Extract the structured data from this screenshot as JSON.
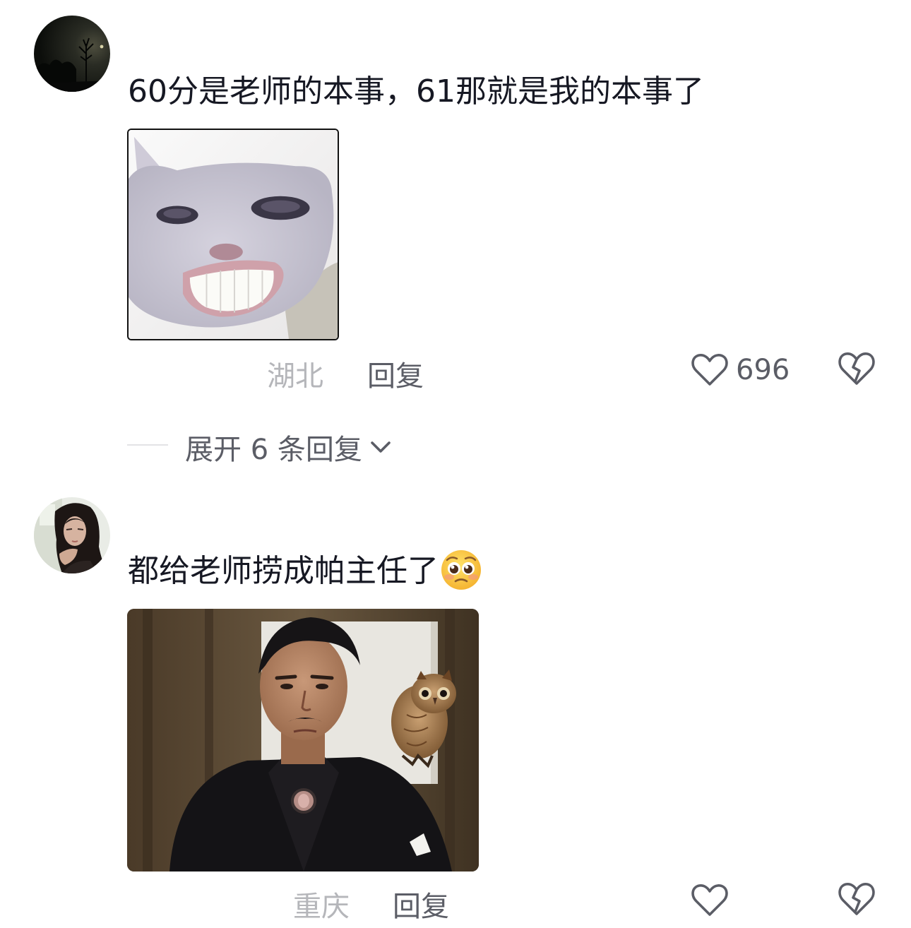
{
  "comments": [
    {
      "text": "60分是老师的本事，61那就是我的本事了",
      "location": "湖北",
      "reply_label": "回复",
      "like_count": "696",
      "image_desc": "smiling-white-cat-meme",
      "avatar_desc": "dark-night-tree-avatar"
    },
    {
      "text": "都给老师捞成帕主任了",
      "emoji": "pleading-face-emoji",
      "location": "重庆",
      "reply_label": "回复",
      "like_count": "",
      "image_desc": "man-in-suit-with-owl-meme",
      "avatar_desc": "woman-portrait-avatar"
    }
  ],
  "expand_replies": {
    "label": "展开 6 条回复"
  },
  "colors": {
    "primary_text": "#161823",
    "secondary_text": "#5b5d66",
    "muted_text": "#b5b6ba",
    "divider": "#e3e3e5",
    "background": "#ffffff"
  },
  "icons": {
    "like": "heart-outline-icon",
    "dislike": "broken-heart-icon",
    "expand": "chevron-down-icon"
  }
}
